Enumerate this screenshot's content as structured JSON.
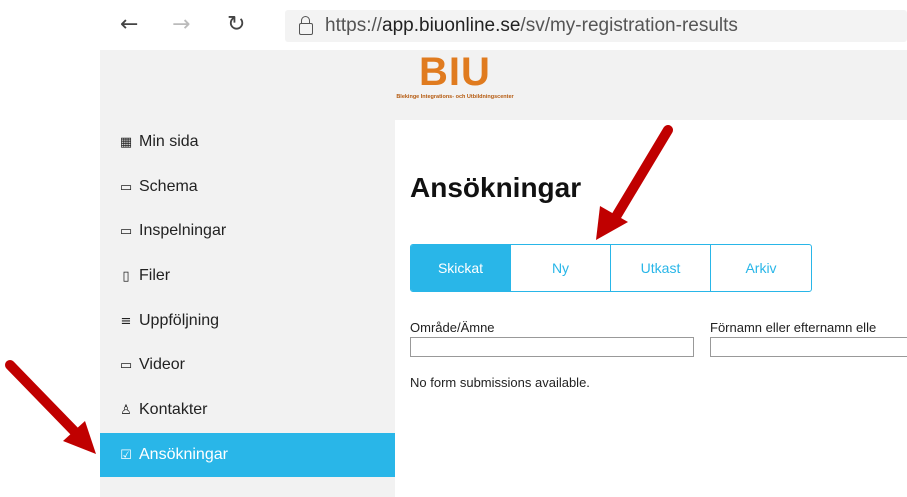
{
  "browser": {
    "back_icon": "←",
    "forward_icon": "→",
    "refresh_icon": "↻",
    "url_prefix": "https://",
    "url_host": "app.biuonline.se",
    "url_path": "/sv/my-registration-results"
  },
  "header": {
    "logo_text": "BIU",
    "logo_subtitle": "Blekinge Integrations- och Utbildningscenter"
  },
  "sidebar": {
    "items": [
      {
        "icon": "▦",
        "label": "Min sida"
      },
      {
        "icon": "▭",
        "label": "Schema"
      },
      {
        "icon": "▭",
        "label": "Inspelningar"
      },
      {
        "icon": "▯",
        "label": "Filer"
      },
      {
        "icon": "≡",
        "label": "Uppföljning"
      },
      {
        "icon": "▭",
        "label": "Videor"
      },
      {
        "icon": "♙",
        "label": "Kontakter"
      },
      {
        "icon": "☑",
        "label": "Ansökningar"
      }
    ]
  },
  "main": {
    "title": "Ansökningar",
    "tabs": [
      {
        "label": "Skickat"
      },
      {
        "label": "Ny"
      },
      {
        "label": "Utkast"
      },
      {
        "label": "Arkiv"
      }
    ],
    "filter_area_label": "Område/Ämne",
    "filter_name_label": "Förnamn eller efternamn elle",
    "empty_message": "No form submissions available."
  },
  "colors": {
    "accent": "#29b6e8",
    "logo": "#e07b1f",
    "arrow": "#c00000"
  }
}
